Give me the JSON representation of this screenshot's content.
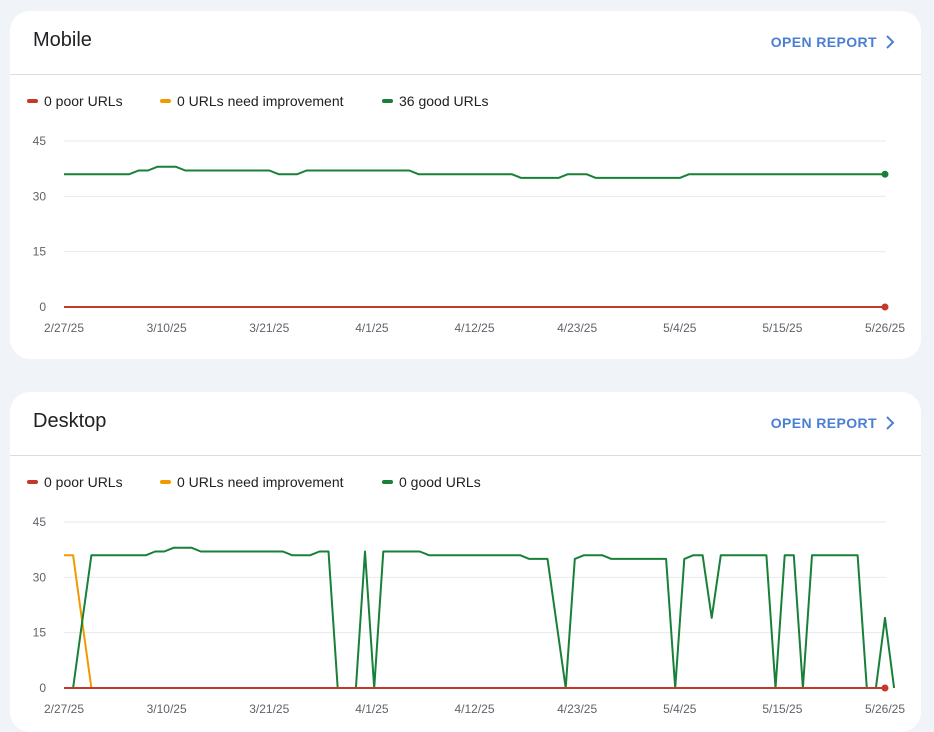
{
  "cards": [
    {
      "id": "mobile",
      "title": "Mobile",
      "open_report_label": "OPEN REPORT",
      "legend": [
        {
          "label": "0 poor URLs",
          "color": "#c5392a"
        },
        {
          "label": "0 URLs need improvement",
          "color": "#f29900"
        },
        {
          "label": "36 good URLs",
          "color": "#188038"
        }
      ]
    },
    {
      "id": "desktop",
      "title": "Desktop",
      "open_report_label": "OPEN REPORT",
      "legend": [
        {
          "label": "0 poor URLs",
          "color": "#c5392a"
        },
        {
          "label": "0 URLs need improvement",
          "color": "#f29900"
        },
        {
          "label": "0 good URLs",
          "color": "#188038"
        }
      ]
    }
  ],
  "chart_data": [
    {
      "type": "line",
      "title": "Mobile",
      "x_tick_labels": [
        "2/27/25",
        "3/10/25",
        "3/21/25",
        "4/1/25",
        "4/12/25",
        "4/23/25",
        "5/4/25",
        "5/15/25",
        "5/26/25"
      ],
      "y_ticks": [
        0,
        15,
        30,
        45
      ],
      "ylim": [
        0,
        45
      ],
      "x_range_days": [
        0,
        88
      ],
      "legend_position": "top-left",
      "grid": true,
      "series": [
        {
          "name": "poor URLs",
          "color": "#c5392a",
          "points": [
            [
              0,
              0
            ],
            [
              88,
              0
            ]
          ],
          "end_marker": true
        },
        {
          "name": "URLs need improvement",
          "color": "#f29900",
          "points": [
            [
              0,
              0
            ],
            [
              88,
              0
            ]
          ],
          "end_marker": false
        },
        {
          "name": "good URLs",
          "color": "#188038",
          "end_marker": true,
          "points": [
            [
              0,
              36
            ],
            [
              7,
              36
            ],
            [
              8,
              37
            ],
            [
              9,
              37
            ],
            [
              10,
              38
            ],
            [
              12,
              38
            ],
            [
              13,
              37
            ],
            [
              22,
              37
            ],
            [
              23,
              36
            ],
            [
              25,
              36
            ],
            [
              26,
              37
            ],
            [
              37,
              37
            ],
            [
              38,
              36
            ],
            [
              48,
              36
            ],
            [
              49,
              35
            ],
            [
              53,
              35
            ],
            [
              54,
              36
            ],
            [
              56,
              36
            ],
            [
              57,
              35
            ],
            [
              66,
              35
            ],
            [
              67,
              36
            ],
            [
              88,
              36
            ]
          ]
        }
      ]
    },
    {
      "type": "line",
      "title": "Desktop",
      "x_tick_labels": [
        "2/27/25",
        "3/10/25",
        "3/21/25",
        "4/1/25",
        "4/12/25",
        "4/23/25",
        "5/4/25",
        "5/15/25",
        "5/26/25"
      ],
      "y_ticks": [
        0,
        15,
        30,
        45
      ],
      "ylim": [
        0,
        45
      ],
      "x_range_days": [
        -2,
        88
      ],
      "legend_position": "top-left",
      "grid": true,
      "series": [
        {
          "name": "poor URLs",
          "color": "#c5392a",
          "points": [
            [
              -2,
              0
            ],
            [
              88,
              0
            ]
          ],
          "end_marker": true
        },
        {
          "name": "URLs need improvement",
          "color": "#f29900",
          "end_marker": false,
          "points": [
            [
              -2,
              36
            ],
            [
              -1,
              36
            ],
            [
              0,
              18
            ],
            [
              1,
              0
            ],
            [
              88,
              0
            ]
          ]
        },
        {
          "name": "good URLs",
          "color": "#188038",
          "end_marker": false,
          "points": [
            [
              -1,
              0
            ],
            [
              0,
              18
            ],
            [
              1,
              36
            ],
            [
              7,
              36
            ],
            [
              8,
              37
            ],
            [
              9,
              37
            ],
            [
              10,
              38
            ],
            [
              12,
              38
            ],
            [
              13,
              37
            ],
            [
              22,
              37
            ],
            [
              23,
              36
            ],
            [
              25,
              36
            ],
            [
              26,
              37
            ],
            [
              27,
              37
            ],
            [
              28,
              0
            ],
            [
              30,
              0
            ],
            [
              31,
              37
            ],
            [
              32,
              0
            ],
            [
              33,
              37
            ],
            [
              37,
              37
            ],
            [
              38,
              36
            ],
            [
              48,
              36
            ],
            [
              49,
              35
            ],
            [
              51,
              35
            ],
            [
              53,
              0
            ],
            [
              54,
              35
            ],
            [
              55,
              36
            ],
            [
              57,
              36
            ],
            [
              58,
              35
            ],
            [
              64,
              35
            ],
            [
              65,
              0
            ],
            [
              66,
              35
            ],
            [
              67,
              36
            ],
            [
              68,
              36
            ],
            [
              69,
              19
            ],
            [
              70,
              36
            ],
            [
              75,
              36
            ],
            [
              76,
              0
            ],
            [
              77,
              36
            ],
            [
              78,
              36
            ],
            [
              79,
              0
            ],
            [
              80,
              36
            ],
            [
              85,
              36
            ],
            [
              86,
              0
            ],
            [
              87,
              0
            ],
            [
              88,
              19
            ],
            [
              89,
              0
            ]
          ]
        }
      ]
    }
  ]
}
